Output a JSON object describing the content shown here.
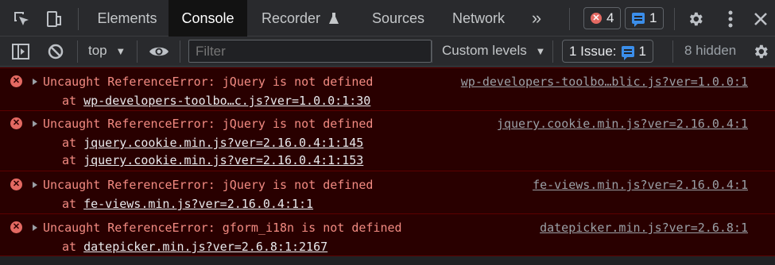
{
  "tabbar": {
    "tabs": [
      {
        "label": "Elements"
      },
      {
        "label": "Console"
      },
      {
        "label": "Recorder"
      },
      {
        "label": "Sources"
      },
      {
        "label": "Network"
      }
    ],
    "more_glyph": "»",
    "error_count": "4",
    "message_count": "1"
  },
  "toolbar": {
    "context": "top",
    "filter_placeholder": "Filter",
    "levels": "Custom levels",
    "issues_label": "1 Issue:",
    "issues_count": "1",
    "hidden": "8 hidden"
  },
  "logs": [
    {
      "message": "Uncaught ReferenceError: jQuery is not defined",
      "source": "wp-developers-toolbo…blic.js?ver=1.0.0:1",
      "stack": [
        {
          "prefix": "at ",
          "link": "wp-developers-toolbo…c.js?ver=1.0.0:1:30"
        }
      ]
    },
    {
      "message": "Uncaught ReferenceError: jQuery is not defined",
      "source": "jquery.cookie.min.js?ver=2.16.0.4:1",
      "stack": [
        {
          "prefix": "at ",
          "link": "jquery.cookie.min.js?ver=2.16.0.4:1:145"
        },
        {
          "prefix": "at ",
          "link": "jquery.cookie.min.js?ver=2.16.0.4:1:153"
        }
      ]
    },
    {
      "message": "Uncaught ReferenceError: jQuery is not defined",
      "source": "fe-views.min.js?ver=2.16.0.4:1",
      "stack": [
        {
          "prefix": "at ",
          "link": "fe-views.min.js?ver=2.16.0.4:1:1"
        }
      ]
    },
    {
      "message": "Uncaught ReferenceError: gform_i18n is not defined",
      "source": "datepicker.min.js?ver=2.6.8:1",
      "stack": [
        {
          "prefix": "at ",
          "link": "datepicker.min.js?ver=2.6.8:1:2167"
        }
      ]
    }
  ]
}
